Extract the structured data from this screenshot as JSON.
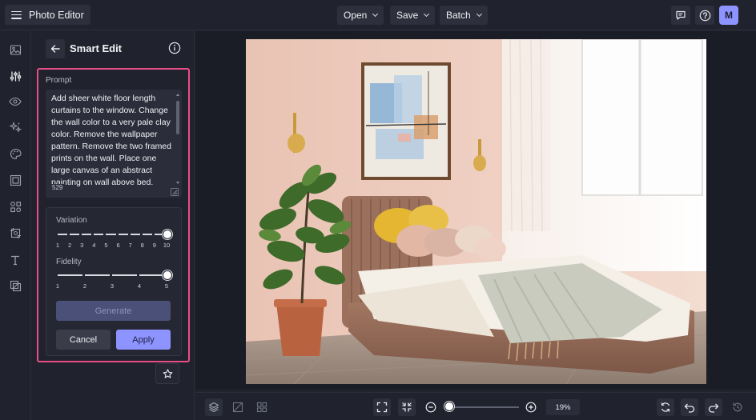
{
  "app": {
    "title": "Photo Editor",
    "avatar_initial": "M",
    "accent_color": "#8d93ff",
    "highlight_color": "#e94d87"
  },
  "topbar": {
    "menus": [
      {
        "label": "Open"
      },
      {
        "label": "Save"
      },
      {
        "label": "Batch"
      }
    ],
    "right_icons": [
      "feedback-icon",
      "help-icon"
    ]
  },
  "rail": {
    "icons": [
      "image-icon",
      "adjust-sliders-icon",
      "eye-icon",
      "sparkle-effects-icon",
      "palette-icon",
      "frame-icon",
      "shapes-icon",
      "crop-icon",
      "text-icon",
      "overlay-icon"
    ]
  },
  "panel": {
    "title": "Smart Edit",
    "prompt_label": "Prompt",
    "prompt_text": "Add sheer white floor length curtains to the window. Change the wall color to a very pale clay color. Remove the wallpaper pattern. Remove the two framed prints on the wall. Place one large canvas of an abstract painting on wall above bed.",
    "char_count": "529",
    "variation": {
      "label": "Variation",
      "ticks": [
        "1",
        "2",
        "3",
        "4",
        "5",
        "6",
        "7",
        "8",
        "9",
        "10"
      ],
      "value": 10
    },
    "fidelity": {
      "label": "Fidelity",
      "ticks": [
        "1",
        "2",
        "3",
        "4",
        "5"
      ],
      "value": 5
    },
    "generate_label": "Generate",
    "cancel_label": "Cancel",
    "apply_label": "Apply"
  },
  "bottombar": {
    "zoom": "19%"
  }
}
